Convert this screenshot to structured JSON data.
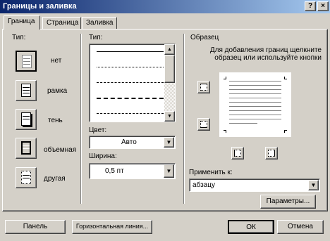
{
  "window": {
    "title": "Границы и заливка"
  },
  "tabs": [
    {
      "label": "Граница",
      "active": true
    },
    {
      "label": "Страница",
      "active": false
    },
    {
      "label": "Заливка",
      "active": false
    }
  ],
  "setting": {
    "label": "Тип:",
    "items": [
      {
        "label": "нет",
        "selected": true
      },
      {
        "label": "рамка",
        "selected": false
      },
      {
        "label": "тень",
        "selected": false
      },
      {
        "label": "объемная",
        "selected": false
      },
      {
        "label": "другая",
        "selected": false
      }
    ]
  },
  "style": {
    "label": "Тип:"
  },
  "color": {
    "label": "Цвет:",
    "value": "Авто"
  },
  "width": {
    "label": "Ширина:",
    "value": "0,5 пт"
  },
  "preview": {
    "label": "Образец",
    "hint": "Для добавления границ щелкните образец или используйте кнопки"
  },
  "apply_to": {
    "label": "Применить к:",
    "value": "абзацу"
  },
  "buttons": {
    "options": "Параметры...",
    "toolbar": "Панель",
    "horizontal_line": "Горизонтальная линия...",
    "ok": "ОК",
    "cancel": "Отмена"
  }
}
